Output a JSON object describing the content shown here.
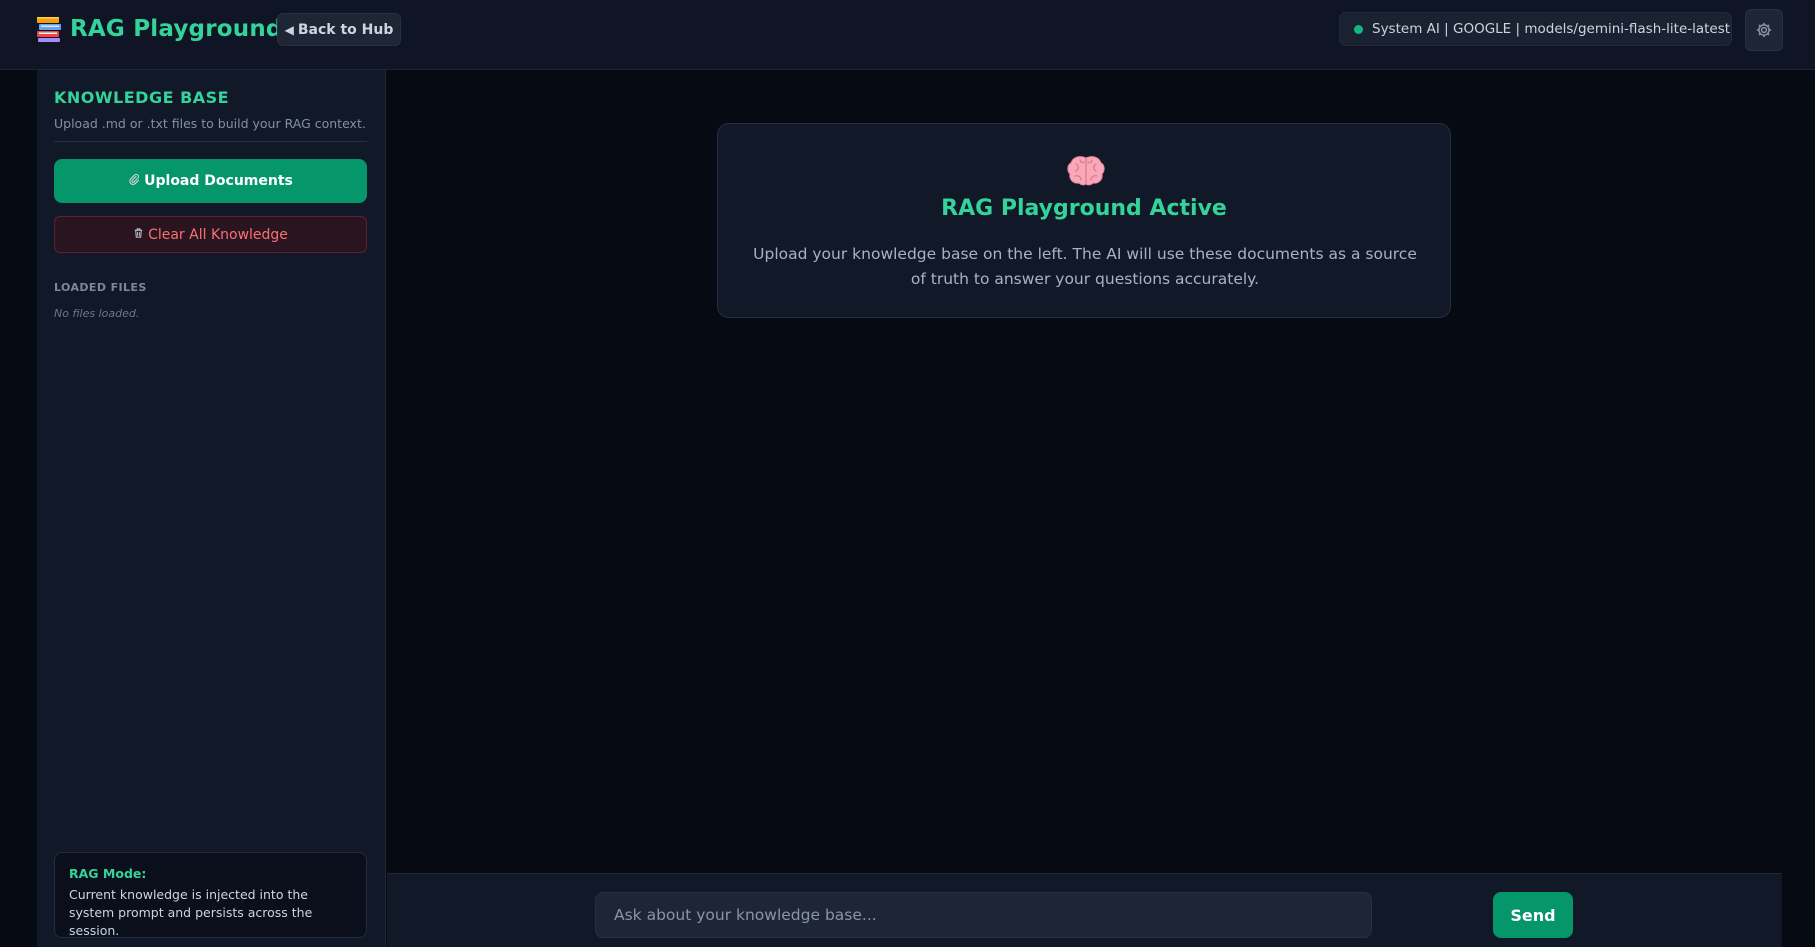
{
  "header": {
    "brand_icon": "books-icon",
    "title": "RAG Playground",
    "back_label": "Back to Hub",
    "status_text": "System AI | GOOGLE | models/gemini-flash-lite-latest",
    "status_color": "#10b981",
    "settings_icon": "gear-icon"
  },
  "sidebar": {
    "title": "KNOWLEDGE BASE",
    "subtitle": "Upload .md or .txt files to build your RAG context.",
    "upload_label": "Upload Documents",
    "upload_icon": "paperclip-icon",
    "clear_label": "Clear All Knowledge",
    "clear_icon": "trash-icon",
    "loaded_title": "LOADED FILES",
    "no_files": "No files loaded.",
    "rag_mode": {
      "title": "RAG Mode:",
      "text": "Current knowledge is injected into the system prompt and persists across the session."
    }
  },
  "main": {
    "card": {
      "icon": "brain-icon",
      "title": "RAG Playground Active",
      "text": "Upload your knowledge base on the left. The AI will use these documents as a source of truth to answer your questions accurately."
    }
  },
  "chat": {
    "placeholder": "Ask about your knowledge base...",
    "value": "",
    "send_label": "Send"
  },
  "colors": {
    "accent": "#34d399",
    "primary_button": "#059669",
    "danger": "#f87171",
    "background": "#060a13",
    "panel": "#111827"
  }
}
